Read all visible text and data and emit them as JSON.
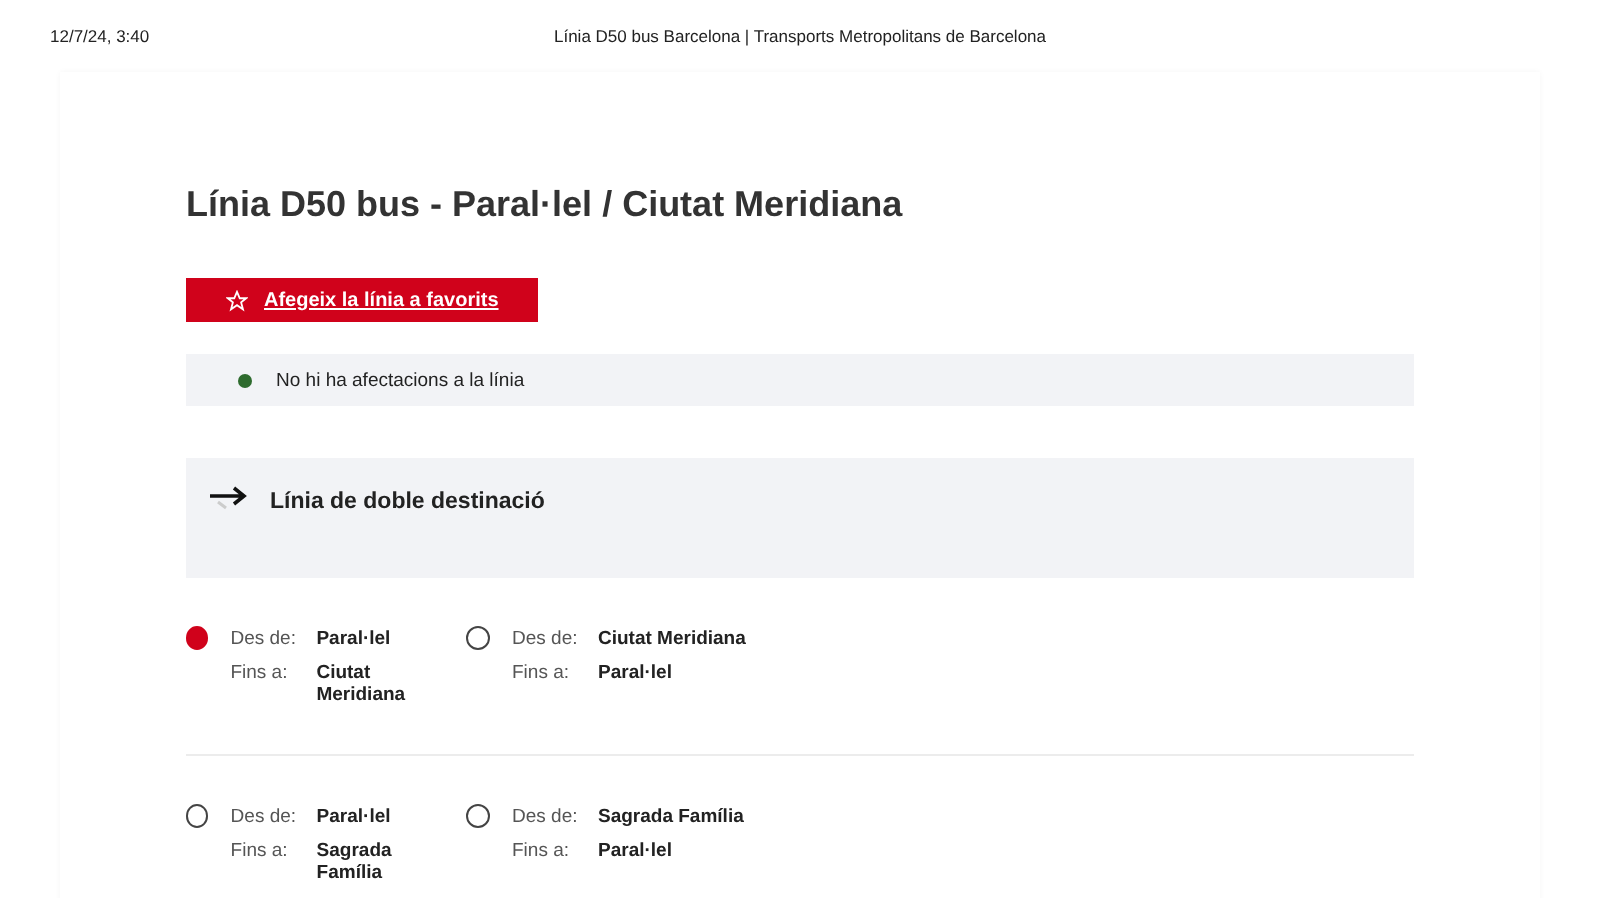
{
  "print_header": {
    "date": "12/7/24, 3:40",
    "title": "Línia D50 bus Barcelona | Transports Metropolitans de Barcelona"
  },
  "heading": "Línia D50 bus - Paral·lel / Ciutat Meridiana",
  "favorite_button": "Afegeix la línia a favorits",
  "status": {
    "text": "No hi ha afectacions a la línia",
    "color": "#2e6b2e"
  },
  "info_box": "Línia de doble destinació",
  "route_groups": [
    {
      "options": [
        {
          "selected": true,
          "from_label": "Des de:",
          "from": "Paral·lel",
          "to_label": "Fins a:",
          "to": "Ciutat Meridiana"
        },
        {
          "selected": false,
          "from_label": "Des de:",
          "from": "Ciutat Meridiana",
          "to_label": "Fins a:",
          "to": "Paral·lel"
        }
      ]
    },
    {
      "options": [
        {
          "selected": false,
          "from_label": "Des de:",
          "from": "Paral·lel",
          "to_label": "Fins a:",
          "to": "Sagrada Família"
        },
        {
          "selected": false,
          "from_label": "Des de:",
          "from": "Sagrada Família",
          "to_label": "Fins a:",
          "to": "Paral·lel"
        }
      ]
    }
  ]
}
